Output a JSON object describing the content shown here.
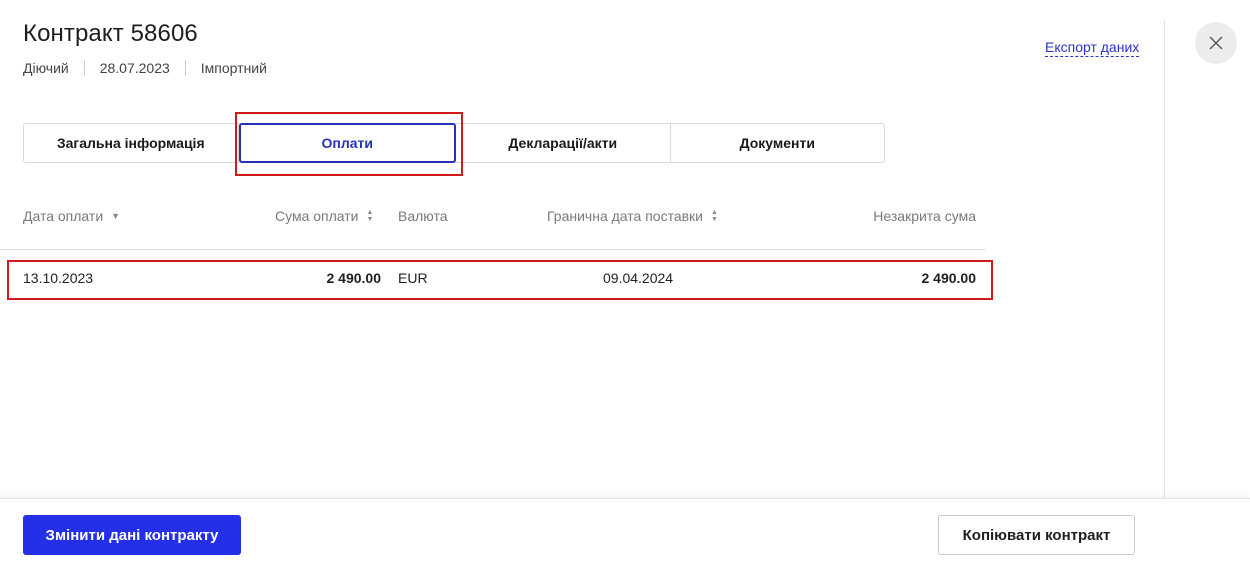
{
  "header": {
    "title": "Контракт 58606",
    "status": "Діючий",
    "date": "28.07.2023",
    "type": "Імпортний",
    "export_label": "Експорт даних",
    "close_icon": "close-icon"
  },
  "tabs": [
    {
      "label": "Загальна інформація",
      "active": false
    },
    {
      "label": "Оплати",
      "active": true
    },
    {
      "label": "Декларації/акти",
      "active": false
    },
    {
      "label": "Документи",
      "active": false
    }
  ],
  "table": {
    "columns": [
      {
        "label": "Дата оплати",
        "sort_icon": "sort-down-icon",
        "sort_glyph": "▼"
      },
      {
        "label": "Сума оплати",
        "sort_icon": "sort-icon",
        "sort_glyph": "▲▼"
      },
      {
        "label": "Валюта"
      },
      {
        "label": "Гранична дата поставки",
        "sort_icon": "sort-icon",
        "sort_glyph": "▲▼"
      },
      {
        "label": "Незакрита сума"
      }
    ],
    "rows": [
      {
        "payment_date": "13.10.2023",
        "amount": "2 490.00",
        "currency": "EUR",
        "deadline": "09.04.2024",
        "open_amount": "2 490.00"
      }
    ]
  },
  "footer": {
    "edit_label": "Змінити дані контракту",
    "copy_label": "Копіювати контракт"
  },
  "colors": {
    "accent": "#2430e8",
    "highlight": "#d31a1a"
  }
}
